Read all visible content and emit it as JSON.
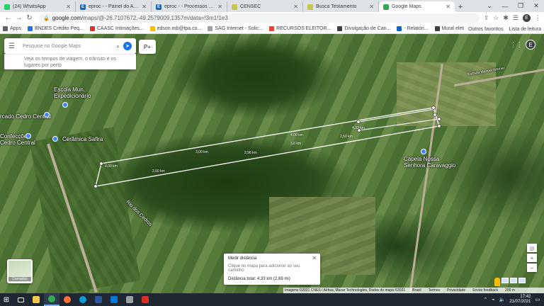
{
  "tabs": [
    {
      "title": "(24) WhatsApp",
      "favicon_color": "#25d366",
      "favicon_glyph": ""
    },
    {
      "title": "eproc - - Painel do Advogad",
      "favicon_color": "#1565c0",
      "favicon_glyph": "E"
    },
    {
      "title": "eproc - - Processos com pr",
      "favicon_color": "#1565c0",
      "favicon_glyph": "E"
    },
    {
      "title": "CENSEC",
      "favicon_color": "#c6c84a",
      "favicon_glyph": ""
    },
    {
      "title": "Busca Testamento",
      "favicon_color": "#c6c84a",
      "favicon_glyph": ""
    },
    {
      "title": "Google Maps",
      "favicon_color": "#34a853",
      "favicon_glyph": ""
    }
  ],
  "active_tab_index": 5,
  "address": {
    "host": "google.com",
    "rest": "/maps/@-26.7107672,-49.2579009,1357m/data=!3m1!1e3"
  },
  "profile_initial": "E",
  "bookmarks": [
    {
      "label": "Apps",
      "color": "#5f6368"
    },
    {
      "label": "BNDES Crédito Peq...",
      "color": "#1a73e8"
    },
    {
      "label": "CAASC Intimações...",
      "color": "#d93025"
    },
    {
      "label": "edson.mb@tpa.co...",
      "color": "#fbbc04"
    },
    {
      "label": "SAG Internet - Solic...",
      "color": "#9aa0a6"
    },
    {
      "label": "RECURSOS ELEITOR...",
      "color": "#ea4335"
    },
    {
      "label": "Divulgação de Can...",
      "color": "#3c4043"
    },
    {
      "label": "- Relatóri...",
      "color": "#1565c0"
    },
    {
      "label": "Mural eletrônico -...",
      "color": "#3c4043"
    }
  ],
  "bookmarks_right": {
    "other": "Outros favoritos",
    "reading": "Lista de leitura"
  },
  "search": {
    "placeholder": "Pesquise no Google Maps"
  },
  "hint": {
    "text": "Veja os tempos de viagem, o trânsito e os lugares por perto"
  },
  "pegman_chip": "P+",
  "map_labels": {
    "school": "Escola Mun. Expedicionário",
    "market": "rcado Cedro Central",
    "confection": "Confecções Cedro Central",
    "ceramic": "Cerâmica Safira",
    "chapel": "Capela Nossa Senhora Caravaggio",
    "river": "Rio dos Cedros",
    "road": "Estrada Manoel Werner"
  },
  "segments": [
    "4,00 km",
    "3,00 km",
    "2,96 km",
    "2,50 km",
    "2,50 km",
    "3,0 km",
    "4,00 km",
    "4,33 km"
  ],
  "measure": {
    "title": "Medir distância",
    "hint": "Clique no mapa para adicionar ao seu caminho",
    "total": "Distância total: 4,33 km (2,69 mi)"
  },
  "layer_label": "Camadas",
  "attribution": {
    "imagery": "Imagens ©2021 CNES / Airbus, Maxar Technologies, Dados do mapa ©2021",
    "brazil": "Brasil",
    "terms": "Termos",
    "privacy": "Privacidade",
    "feedback": "Enviar feedback",
    "scale": "200 m"
  },
  "clock": {
    "time": "17:42",
    "date": "21/07/2021"
  },
  "taskbar_apps": [
    {
      "name": "file-explorer",
      "color": "#f2c94c"
    },
    {
      "name": "chrome",
      "color": "#34a853"
    },
    {
      "name": "firefox",
      "color": "#ff7139"
    },
    {
      "name": "edge",
      "color": "#0f9bd7"
    },
    {
      "name": "word",
      "color": "#2b579a"
    },
    {
      "name": "photos",
      "color": "#0078d4"
    },
    {
      "name": "onedrive",
      "color": "#9aa0a6"
    },
    {
      "name": "app-red",
      "color": "#d93025"
    }
  ]
}
